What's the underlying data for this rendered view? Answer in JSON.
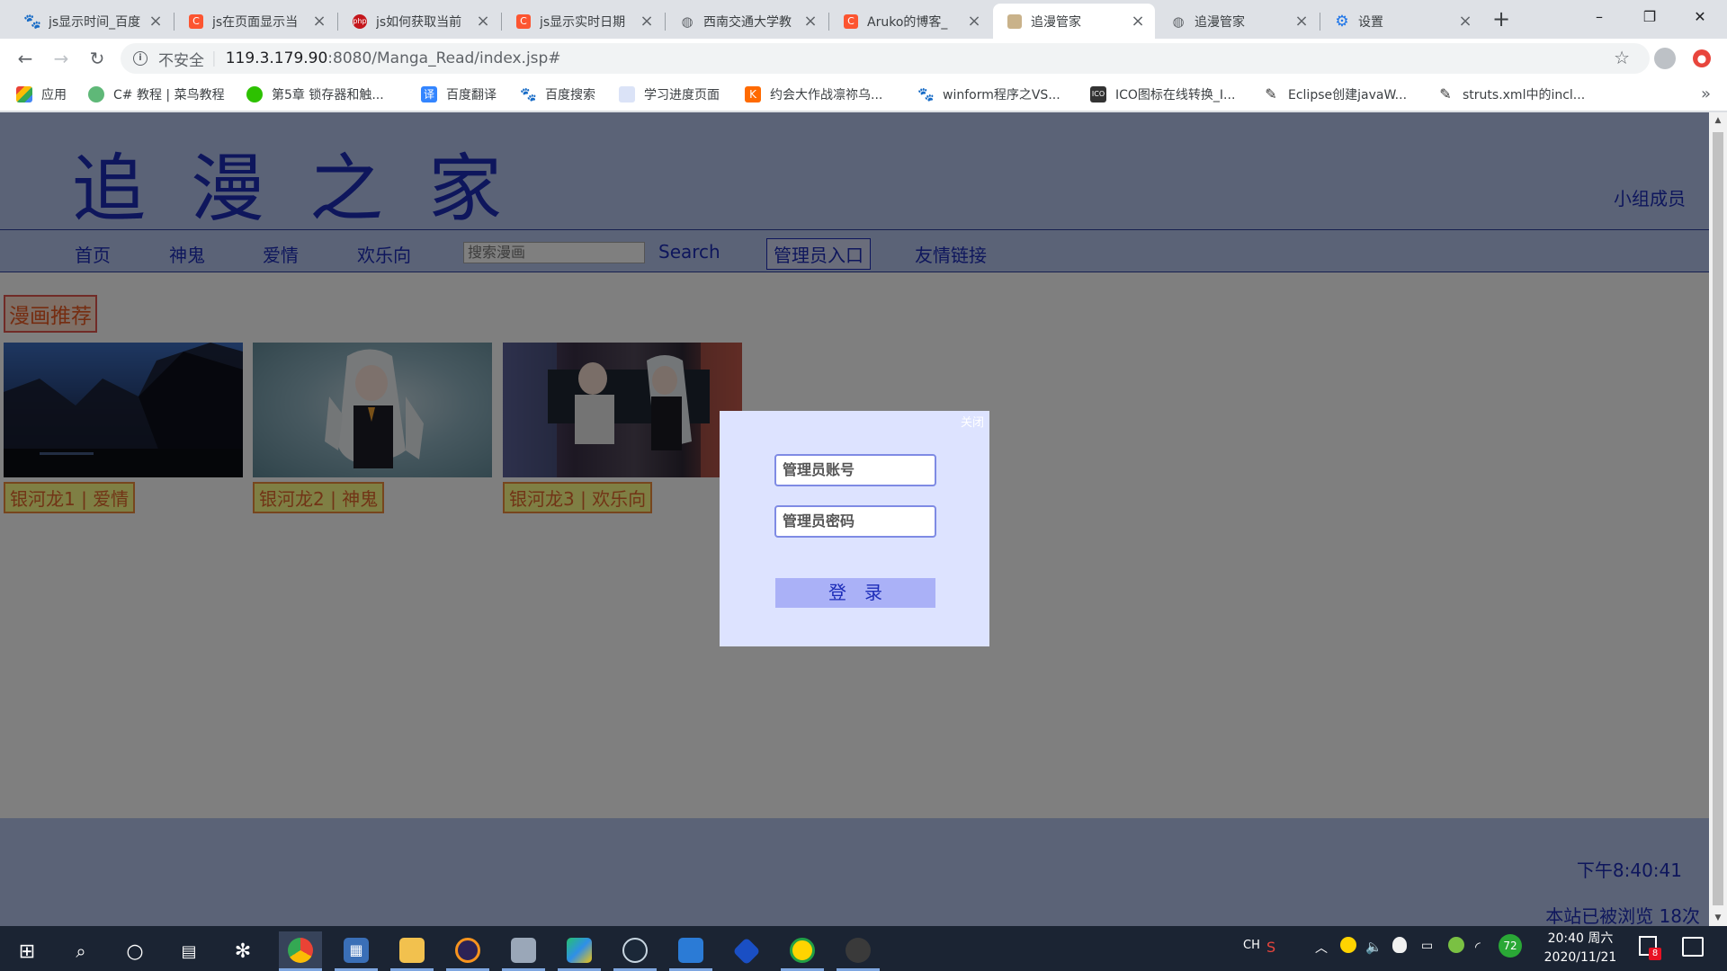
{
  "browser": {
    "tabs": [
      {
        "title": "js显示时间_百度",
        "favicon": "baidu-paw",
        "color": "#2932e1"
      },
      {
        "title": "js在页面显示当",
        "favicon": "csdn-c",
        "color": "#fc5531"
      },
      {
        "title": "js如何获取当前",
        "favicon": "php-badge",
        "color": "#c4161c"
      },
      {
        "title": "js显示实时日期",
        "favicon": "csdn-c",
        "color": "#fc5531"
      },
      {
        "title": "西南交通大学教",
        "favicon": "globe",
        "color": "#5f6368"
      },
      {
        "title": "Aruko的博客_",
        "favicon": "csdn-c",
        "color": "#fc5531"
      },
      {
        "title": "追漫管家",
        "favicon": "page-thumb",
        "color": "#8a6d3b",
        "active": true
      },
      {
        "title": "追漫管家",
        "favicon": "globe",
        "color": "#5f6368"
      },
      {
        "title": "设置",
        "favicon": "gear",
        "color": "#1a73e8"
      }
    ],
    "address": {
      "security_label": "不安全",
      "host": "119.3.179.90",
      "path": ":8080/Manga_Read/index.jsp#"
    },
    "bookmarks": [
      {
        "label": "应用",
        "icon": "apps-grid",
        "color": "#e94235"
      },
      {
        "label": "C# 教程 | 菜鸟教程",
        "icon": "runoob",
        "color": "#5fb878"
      },
      {
        "label": "第5章 锁存器和触...",
        "icon": "wechat",
        "color": "#2dc100"
      },
      {
        "label": "百度翻译",
        "icon": "baidu-translate",
        "color": "#3385ff"
      },
      {
        "label": "百度搜索",
        "icon": "baidu-paw",
        "color": "#2932e1"
      },
      {
        "label": "学习进度页面",
        "icon": "blank-page",
        "color": "#dbe3f7"
      },
      {
        "label": "约会大作战凛祢乌...",
        "icon": "k-logo",
        "color": "#ff6a00"
      },
      {
        "label": "winform程序之VS...",
        "icon": "baidu-paw",
        "color": "#2932e1"
      },
      {
        "label": "ICO图标在线转换_I...",
        "icon": "ico-logo",
        "color": "#333333"
      },
      {
        "label": "Eclipse创建javaW...",
        "icon": "feather",
        "color": "#333333"
      },
      {
        "label": "struts.xml中的incl...",
        "icon": "feather",
        "color": "#333333"
      }
    ]
  },
  "site": {
    "title": "追漫之家",
    "members_link": "小组成员",
    "nav": {
      "home": "首页",
      "ghost": "神鬼",
      "love": "爱情",
      "comedy": "欢乐向",
      "search_placeholder": "搜索漫画",
      "search_button": "Search",
      "admin": "管理员入口",
      "links": "友情链接"
    },
    "section_title": "漫画推荐",
    "cards": [
      {
        "caption": "银河龙1 | 爱情"
      },
      {
        "caption": "银河龙2 | 神鬼"
      },
      {
        "caption": "银河龙3 | 欢乐向"
      }
    ],
    "footer": {
      "clock": "下午8:40:41",
      "visits": "本站已被浏览 18次"
    }
  },
  "modal": {
    "close_label": "关闭",
    "account_placeholder": "管理员账号",
    "password_placeholder": "管理员密码",
    "login_button": "登录"
  },
  "taskbar": {
    "tray_lang": "CH",
    "tray_badge": "72",
    "time": "20:40 周六",
    "date": "2020/11/21",
    "notification_count": "8"
  }
}
